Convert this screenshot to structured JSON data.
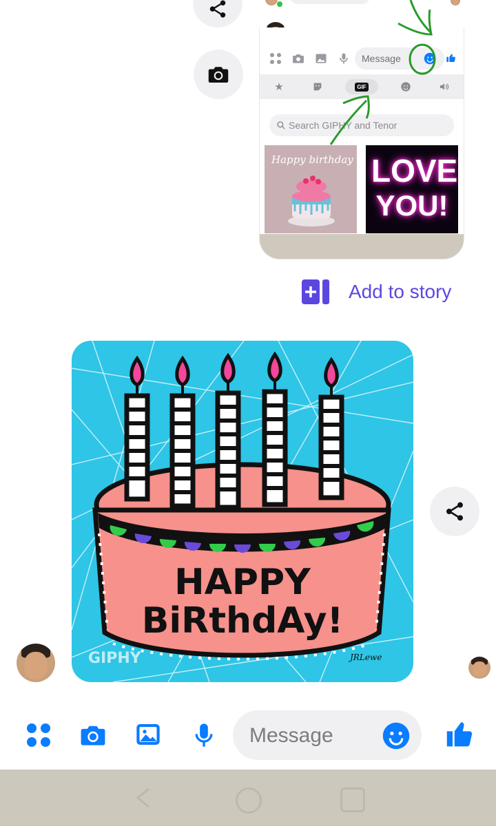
{
  "embedded_screenshot": {
    "message_placeholder": "Message",
    "tabs": [
      "star",
      "sticker",
      "GIF",
      "emoji",
      "sound"
    ],
    "active_tab": "GIF",
    "search_placeholder": "Search GIPHY and Tenor",
    "gifs": [
      {
        "label": "Happy birthday"
      },
      {
        "label_line1": "LOVE",
        "label_line2": "YOU!"
      }
    ]
  },
  "add_to_story": {
    "label": "Add to story"
  },
  "main_gif": {
    "line1": "HAPPY",
    "line2": "BiRthdAy!",
    "watermark": "GIPHY",
    "signature": "JRLewe"
  },
  "composer": {
    "placeholder": "Message",
    "icons": [
      "apps-icon",
      "camera-icon",
      "gallery-icon",
      "mic-icon",
      "emoji-icon",
      "like-icon"
    ]
  },
  "colors": {
    "accent": "#0a7cff",
    "story_purple": "#5b47e0",
    "annotation_green": "#2a9a2a",
    "gif_background": "#2ec5e6",
    "cake_pink": "#f6918b"
  }
}
